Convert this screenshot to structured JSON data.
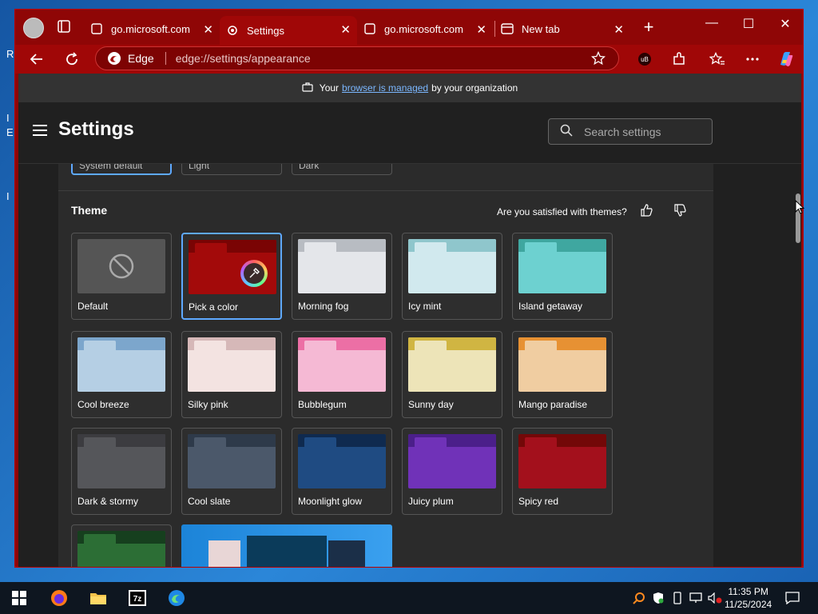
{
  "desktop": {
    "left_chars": [
      "R",
      "I",
      "E",
      "I"
    ]
  },
  "tabs": [
    {
      "title": "go.microsoft.com",
      "close": "✕"
    },
    {
      "title": "Settings",
      "close": "✕"
    },
    {
      "title": "go.microsoft.com",
      "close": "✕"
    },
    {
      "title": "New tab",
      "close": "✕"
    }
  ],
  "new_tab": "+",
  "window_controls": {
    "minimize": "—",
    "maximize": "☐",
    "close": "✕"
  },
  "address_bar": {
    "site_label": "Edge",
    "url": "edge://settings/appearance"
  },
  "managed": {
    "prefix": "Your",
    "link": "browser is managed",
    "suffix": "by your organization"
  },
  "settings": {
    "title": "Settings",
    "search_placeholder": "Search settings",
    "modes": [
      "System default",
      "Light",
      "Dark"
    ],
    "theme_heading": "Theme",
    "satisfied": "Are you satisfied with themes?"
  },
  "themes": [
    {
      "name": "Default",
      "top": "#555555",
      "body": "#555555"
    },
    {
      "name": "Pick a color",
      "top": "#7a0404",
      "body": "#a30a0a"
    },
    {
      "name": "Morning fog",
      "top": "#b8bcc2",
      "body": "#e4e6ea"
    },
    {
      "name": "Icy mint",
      "top": "#8fc6cc",
      "body": "#d1e9ee"
    },
    {
      "name": "Island getaway",
      "top": "#3fa7a0",
      "body": "#6dd1d0"
    },
    {
      "name": "Cool breeze",
      "top": "#7ca6cc",
      "body": "#b5cfe4"
    },
    {
      "name": "Silky pink",
      "top": "#d6b8b8",
      "body": "#f3e3e1"
    },
    {
      "name": "Bubblegum",
      "top": "#ec6fa5",
      "body": "#f5b9d4"
    },
    {
      "name": "Sunny day",
      "top": "#d0b542",
      "body": "#ede4b8"
    },
    {
      "name": "Mango paradise",
      "top": "#e79133",
      "body": "#f0cda1"
    },
    {
      "name": "Dark & stormy",
      "top": "#3c3c40",
      "body": "#55565a"
    },
    {
      "name": "Cool slate",
      "top": "#2e3a4a",
      "body": "#4b586a"
    },
    {
      "name": "Moonlight glow",
      "top": "#0f2a4f",
      "body": "#1f4b82"
    },
    {
      "name": "Juicy plum",
      "top": "#4b1f8a",
      "body": "#7032b8"
    },
    {
      "name": "Spicy red",
      "top": "#730808",
      "body": "#a3101c"
    },
    {
      "name": "",
      "top": "#163f1e",
      "body": "#2c6e35"
    }
  ],
  "clock": {
    "time": "11:35 PM",
    "date": "11/25/2024"
  }
}
